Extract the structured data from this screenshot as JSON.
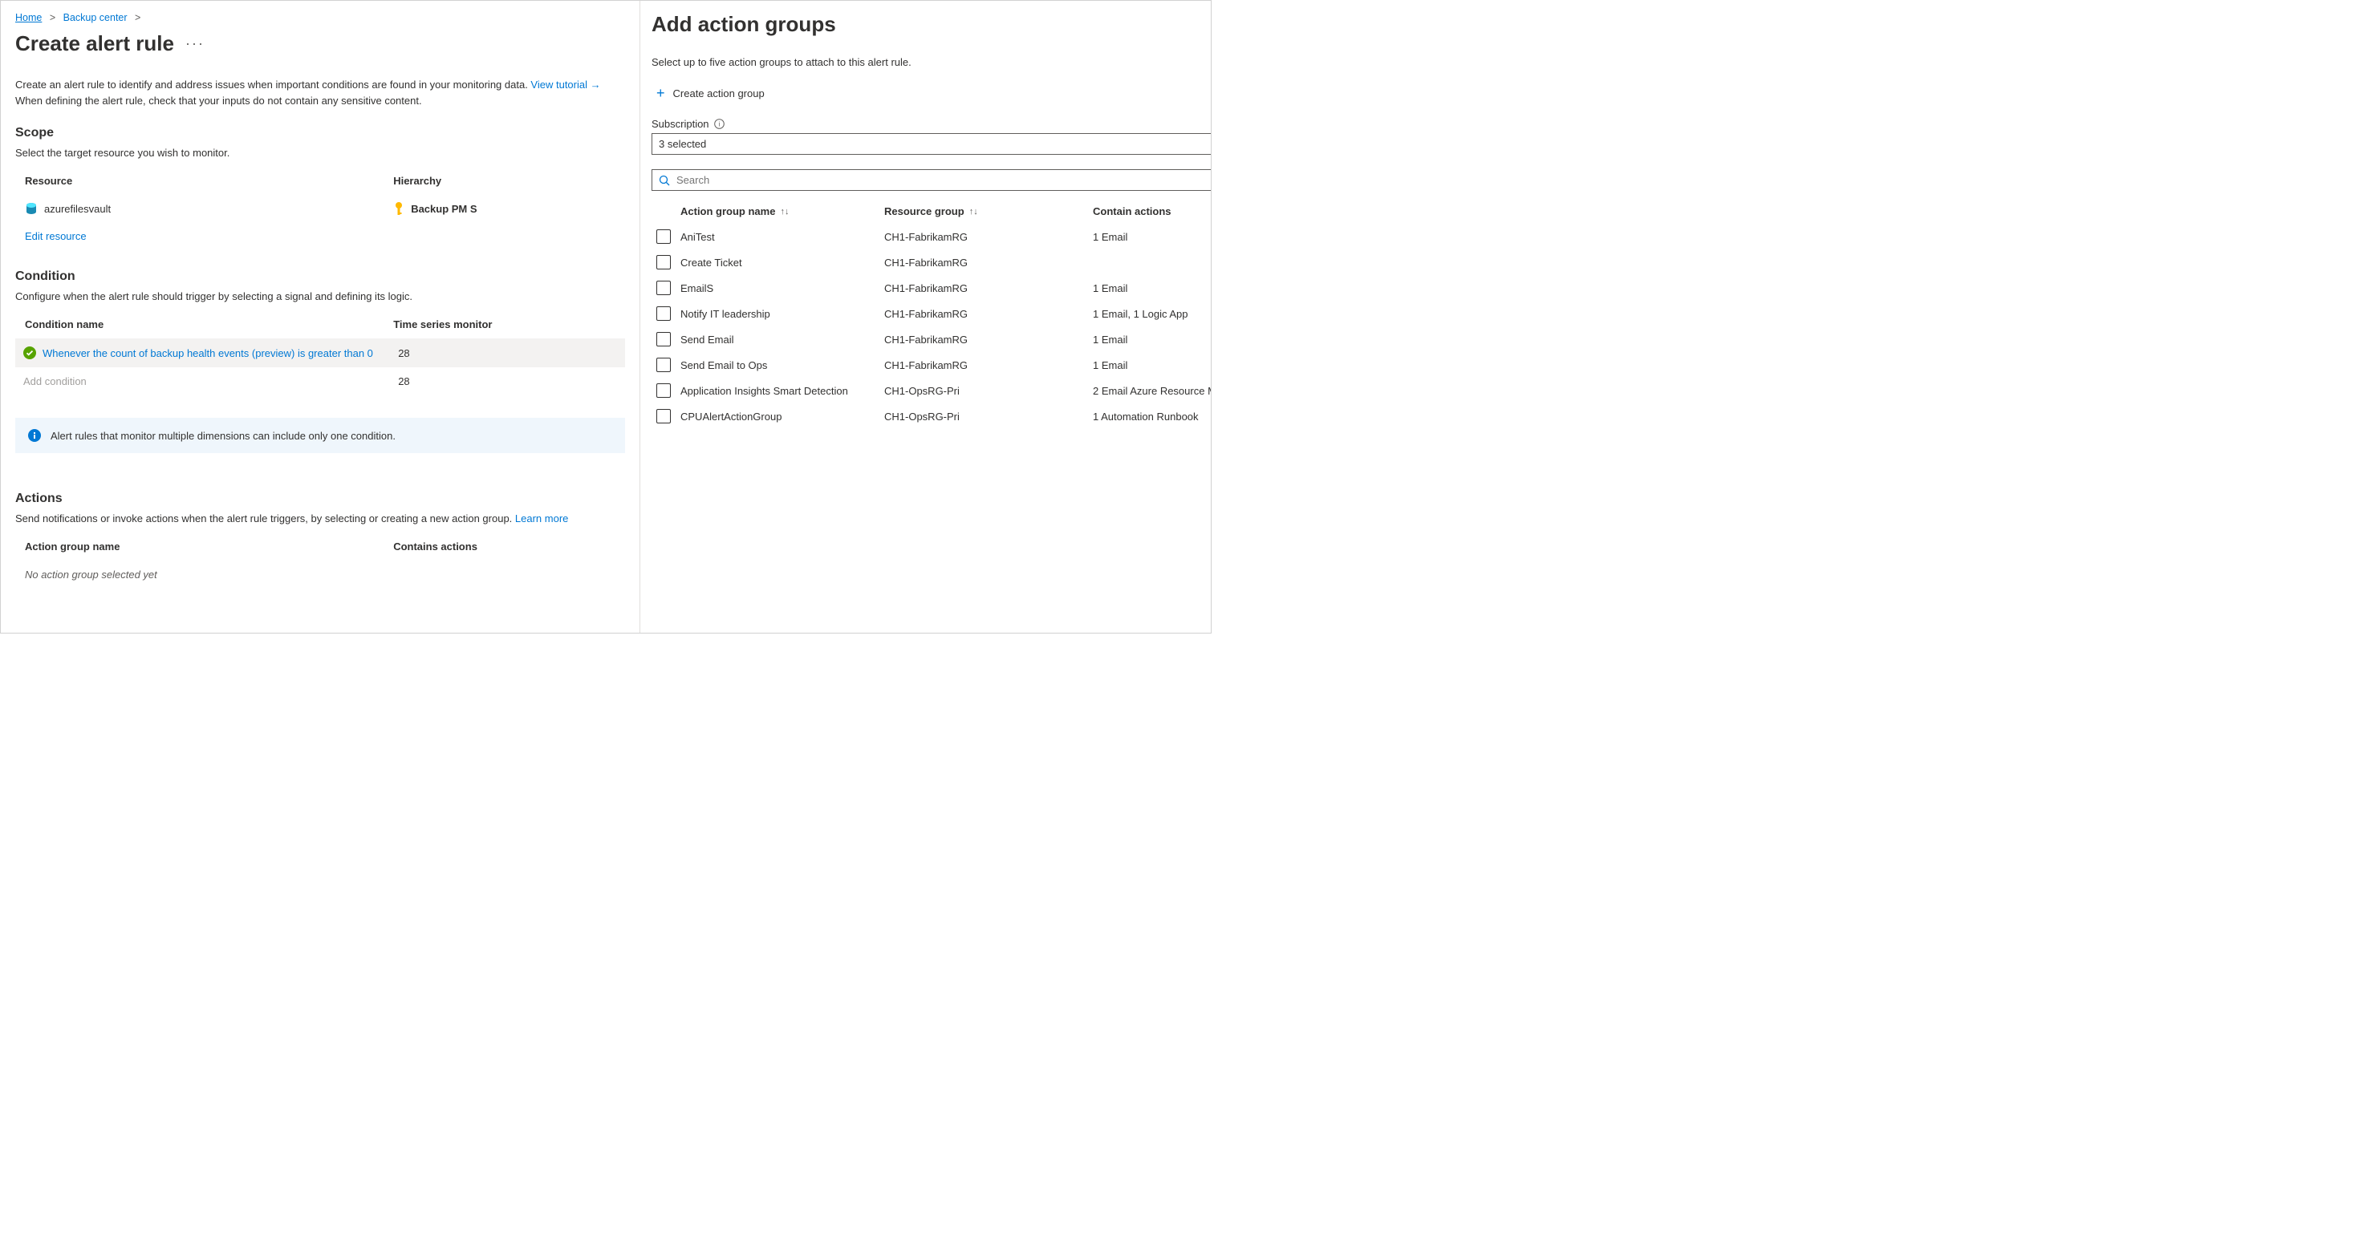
{
  "breadcrumb": {
    "home": "Home",
    "backup_center": "Backup center"
  },
  "page_title": "Create alert rule",
  "intro_1": "Create an alert rule to identify and address issues when important conditions are found in your monitoring data. ",
  "intro_link": "View tutorial →",
  "intro_2": "When defining the alert rule, check that your inputs do not contain any sensitive content.",
  "scope": {
    "heading": "Scope",
    "sub": "Select the target resource you wish to monitor.",
    "col_resource": "Resource",
    "col_hierarchy": "Hierarchy",
    "row_resource": "azurefilesvault",
    "row_hierarchy": "Backup PM S",
    "edit_link": "Edit resource"
  },
  "condition": {
    "heading": "Condition",
    "sub": "Configure when the alert rule should trigger by selecting a signal and defining its logic.",
    "col_name": "Condition name",
    "col_ts": "Time series monitor",
    "row_name": "Whenever the count of backup health events (preview) is greater than 0",
    "row_ts": "28",
    "add_label": "Add condition",
    "add_ts": "28",
    "info": "Alert rules that monitor multiple dimensions can include only one condition."
  },
  "actions": {
    "heading": "Actions",
    "sub_1": "Send notifications or invoke actions when the alert rule triggers, by selecting or creating a new action group. ",
    "learn_more": "Learn more",
    "col_name": "Action group name",
    "col_contains": "Contains actions",
    "empty": "No action group selected yet"
  },
  "panel": {
    "title": "Add action groups",
    "sub": "Select up to five action groups to attach to this alert rule.",
    "create_label": "Create action group",
    "sub_label": "Subscription",
    "sub_value": "3 selected",
    "search_placeholder": "Search",
    "col_name": "Action group name",
    "col_rg": "Resource group",
    "col_actions": "Contain actions",
    "rows": [
      {
        "name": "AniTest",
        "rg": "CH1-FabrikamRG",
        "actions": "1 Email"
      },
      {
        "name": "Create Ticket",
        "rg": "CH1-FabrikamRG",
        "actions": ""
      },
      {
        "name": "EmailS",
        "rg": "CH1-FabrikamRG",
        "actions": "1 Email"
      },
      {
        "name": "Notify IT leadership",
        "rg": "CH1-FabrikamRG",
        "actions": "1 Email, 1 Logic App"
      },
      {
        "name": "Send Email",
        "rg": "CH1-FabrikamRG",
        "actions": "1 Email"
      },
      {
        "name": "Send Email to Ops",
        "rg": "CH1-FabrikamRG",
        "actions": "1 Email"
      },
      {
        "name": "Application Insights Smart Detection",
        "rg": "CH1-OpsRG-Pri",
        "actions": "2 Email Azure Resource M"
      },
      {
        "name": "CPUAlertActionGroup",
        "rg": "CH1-OpsRG-Pri",
        "actions": "1 Automation Runbook"
      }
    ]
  }
}
